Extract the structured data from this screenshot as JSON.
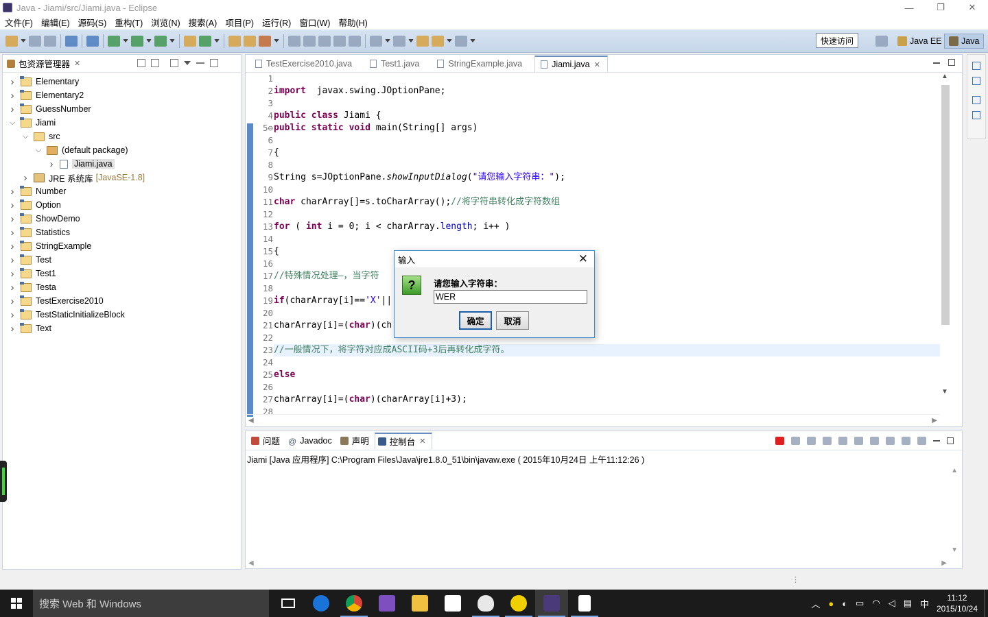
{
  "window": {
    "title": "Java  -  Jiami/src/Jiami.java  -  Eclipse",
    "minimize": "—",
    "restore": "❐",
    "close": "✕"
  },
  "menu": [
    "文件(F)",
    "编辑(E)",
    "源码(S)",
    "重构(T)",
    "浏览(N)",
    "搜索(A)",
    "项目(P)",
    "运行(R)",
    "窗口(W)",
    "帮助(H)"
  ],
  "toolbar": {
    "quick_access": "快速访问",
    "perspectives": [
      "Java EE",
      "Java"
    ]
  },
  "package_explorer": {
    "title": "包资源管理器",
    "items": [
      {
        "label": "Elementary",
        "level": 0,
        "kind": "project",
        "expanded": false
      },
      {
        "label": "Elementary2",
        "level": 0,
        "kind": "project",
        "expanded": false
      },
      {
        "label": "GuessNumber",
        "level": 0,
        "kind": "project",
        "expanded": false
      },
      {
        "label": "Jiami",
        "level": 0,
        "kind": "project",
        "expanded": true
      },
      {
        "label": "src",
        "level": 1,
        "kind": "src",
        "expanded": true
      },
      {
        "label": "(default package)",
        "level": 2,
        "kind": "package",
        "expanded": true
      },
      {
        "label": "Jiami.java",
        "level": 3,
        "kind": "java",
        "expanded": false,
        "selected": true
      },
      {
        "label": "JRE 系统库",
        "decoration": "[JavaSE-1.8]",
        "level": 1,
        "kind": "jre",
        "expanded": false
      },
      {
        "label": "Number",
        "level": 0,
        "kind": "project",
        "expanded": false
      },
      {
        "label": "Option",
        "level": 0,
        "kind": "project",
        "expanded": false
      },
      {
        "label": "ShowDemo",
        "level": 0,
        "kind": "project",
        "expanded": false
      },
      {
        "label": "Statistics",
        "level": 0,
        "kind": "project",
        "expanded": false
      },
      {
        "label": "StringExample",
        "level": 0,
        "kind": "project",
        "expanded": false
      },
      {
        "label": "Test",
        "level": 0,
        "kind": "project",
        "expanded": false
      },
      {
        "label": "Test1",
        "level": 0,
        "kind": "project",
        "expanded": false
      },
      {
        "label": "Testa",
        "level": 0,
        "kind": "project",
        "expanded": false
      },
      {
        "label": "TestExercise2010",
        "level": 0,
        "kind": "project",
        "expanded": false
      },
      {
        "label": "TestStaticInitializeBlock",
        "level": 0,
        "kind": "project",
        "expanded": false
      },
      {
        "label": "Text",
        "level": 0,
        "kind": "project",
        "expanded": false
      }
    ]
  },
  "editor": {
    "tabs": [
      {
        "label": "TestExercise2010.java",
        "active": false
      },
      {
        "label": "Test1.java",
        "active": false
      },
      {
        "label": "StringExample.java",
        "active": false
      },
      {
        "label": "Jiami.java",
        "active": true
      }
    ],
    "current_line": 23,
    "lines": [
      {
        "n": "1",
        "tokens": []
      },
      {
        "n": "2",
        "tokens": [
          [
            "kw",
            "import"
          ],
          [
            "",
            "  javax.swing.JOptionPane;"
          ]
        ]
      },
      {
        "n": "3",
        "tokens": []
      },
      {
        "n": "4",
        "tokens": [
          [
            "kw",
            "public"
          ],
          [
            "",
            " "
          ],
          [
            "kw",
            "class"
          ],
          [
            "",
            " Jiami {"
          ]
        ]
      },
      {
        "n": "5⊖",
        "tokens": [
          [
            "kw",
            "public"
          ],
          [
            "",
            " "
          ],
          [
            "kw",
            "static"
          ],
          [
            "",
            " "
          ],
          [
            "kw",
            "void"
          ],
          [
            "",
            " main(String[] args)"
          ]
        ]
      },
      {
        "n": "6",
        "tokens": []
      },
      {
        "n": "7",
        "tokens": [
          [
            "",
            "{"
          ]
        ]
      },
      {
        "n": "8",
        "tokens": []
      },
      {
        "n": "9",
        "tokens": [
          [
            "",
            "String s=JOptionPane."
          ],
          [
            "it",
            "showInputDialog"
          ],
          [
            "",
            "("
          ],
          [
            "str",
            "\"请您输入字符串：\""
          ],
          [
            "",
            ");"
          ]
        ]
      },
      {
        "n": "10",
        "tokens": []
      },
      {
        "n": "11",
        "tokens": [
          [
            "kw",
            "char"
          ],
          [
            "",
            " charArray[]=s.toCharArray();"
          ],
          [
            "cm",
            "//将字符串转化成字符数组"
          ]
        ]
      },
      {
        "n": "12",
        "tokens": []
      },
      {
        "n": "13",
        "tokens": [
          [
            "kw",
            "for"
          ],
          [
            "",
            " ( "
          ],
          [
            "kw",
            "int"
          ],
          [
            "",
            " i = 0; i < charArray."
          ],
          [
            "fld",
            "length"
          ],
          [
            "",
            "; i++ )"
          ]
        ]
      },
      {
        "n": "14",
        "tokens": []
      },
      {
        "n": "15",
        "tokens": [
          [
            "",
            "{"
          ]
        ]
      },
      {
        "n": "16",
        "tokens": []
      },
      {
        "n": "17",
        "tokens": [
          [
            "cm",
            "//特殊情况处理—，当字符"
          ]
        ]
      },
      {
        "n": "18",
        "tokens": []
      },
      {
        "n": "19",
        "tokens": [
          [
            "kw",
            "if"
          ],
          [
            "",
            "(charArray[i]=="
          ],
          [
            "str",
            "'X'"
          ],
          [
            "",
            "||"
          ]
        ]
      },
      {
        "n": "20",
        "tokens": []
      },
      {
        "n": "21",
        "tokens": [
          [
            "",
            "charArray[i]=("
          ],
          [
            "kw",
            "char"
          ],
          [
            "",
            ")(ch"
          ]
        ]
      },
      {
        "n": "22",
        "tokens": []
      },
      {
        "n": "23",
        "tokens": [
          [
            "cm",
            "//一般情况下，将字符对应成ASCII码+3后再转化成字符。"
          ]
        ]
      },
      {
        "n": "24",
        "tokens": []
      },
      {
        "n": "25",
        "tokens": [
          [
            "kw",
            "else"
          ]
        ]
      },
      {
        "n": "26",
        "tokens": []
      },
      {
        "n": "27",
        "tokens": [
          [
            "",
            "charArray[i]=("
          ],
          [
            "kw",
            "char"
          ],
          [
            "",
            ")(charArray[i]+3);"
          ]
        ]
      },
      {
        "n": "28",
        "tokens": []
      }
    ]
  },
  "console": {
    "tabs": [
      {
        "label": "问题",
        "active": false
      },
      {
        "label": "Javadoc",
        "active": false
      },
      {
        "label": "声明",
        "active": false
      },
      {
        "label": "控制台",
        "active": true
      }
    ],
    "launch_info": "Jiami [Java 应用程序] C:\\Program Files\\Java\\jre1.8.0_51\\bin\\javaw.exe ( 2015年10月24日 上午11:12:26 )"
  },
  "dialog": {
    "title": "输入",
    "icon": "question-icon",
    "icon_glyph": "?",
    "prompt": "请您输入字符串：",
    "input_value": "WER",
    "ok": "确定",
    "cancel": "取消"
  },
  "taskbar": {
    "search_placeholder": "搜索 Web 和 Windows",
    "ime": "中",
    "time": "11:12",
    "date": "2015/10/24"
  },
  "colors": {
    "keyword": "#7f0055",
    "string": "#2a00ff",
    "comment": "#3f7f5f",
    "field": "#0000c0",
    "accent": "#3a70b8"
  }
}
